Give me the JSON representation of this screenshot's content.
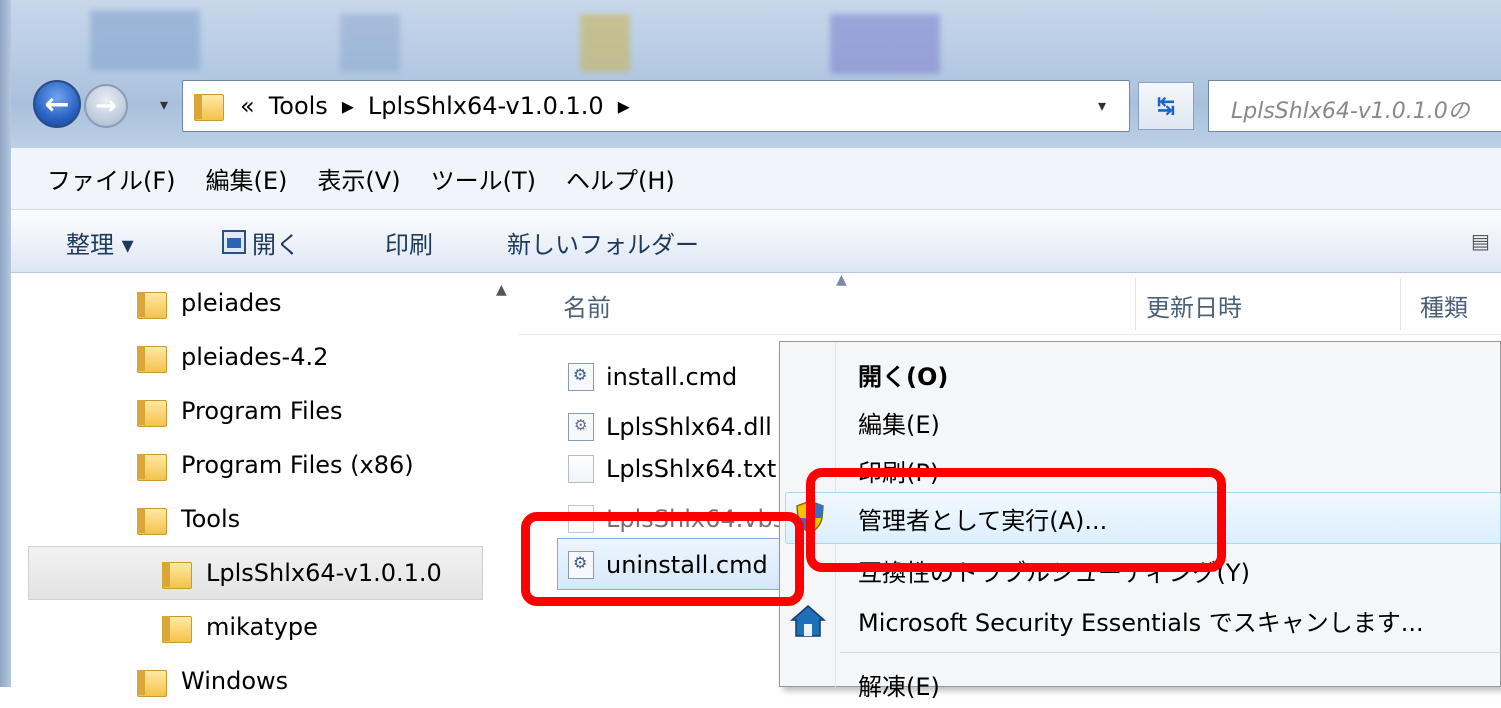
{
  "address": {
    "overflow": "«",
    "crumbs": [
      "Tools",
      "LplsShlx64-v1.0.1.0"
    ],
    "search_placeholder": "LplsShlx64-v1.0.1.0の"
  },
  "menubar": [
    "ファイル(F)",
    "編集(E)",
    "表示(V)",
    "ツール(T)",
    "ヘルプ(H)"
  ],
  "toolbar": {
    "organize": "整理 ▾",
    "open": "開く",
    "print": "印刷",
    "new_folder": "新しいフォルダー"
  },
  "nav": {
    "items": [
      "pleiades",
      "pleiades-4.2",
      "Program Files",
      "Program Files (x86)",
      "Tools",
      "LplsShlx64-v1.0.1.0",
      "mikatype",
      "Windows"
    ],
    "selected": "LplsShlx64-v1.0.1.0"
  },
  "columns": [
    "名前",
    "更新日時",
    "種類"
  ],
  "files": [
    {
      "name": "install.cmd",
      "icon": "cmd-file-icon"
    },
    {
      "name": "LplsShlx64.dll",
      "icon": "dll-file-icon"
    },
    {
      "name": "LplsShlx64.txt",
      "icon": "txt-file-icon"
    },
    {
      "name": "LplsShlx64.vbs",
      "icon": "vbs-file-icon"
    },
    {
      "name": "uninstall.cmd",
      "icon": "cmd-file-icon"
    }
  ],
  "context_menu": {
    "items": [
      "開く(O)",
      "編集(E)",
      "印刷(P)",
      "管理者として実行(A)...",
      "互換性のトラブルシューティング(Y)",
      "Microsoft Security Essentials でスキャンします...",
      "解凍(E)"
    ],
    "highlighted": "管理者として実行(A)..."
  },
  "colors": {
    "annotation": "#ff0000",
    "highlight": "#dcefff"
  }
}
